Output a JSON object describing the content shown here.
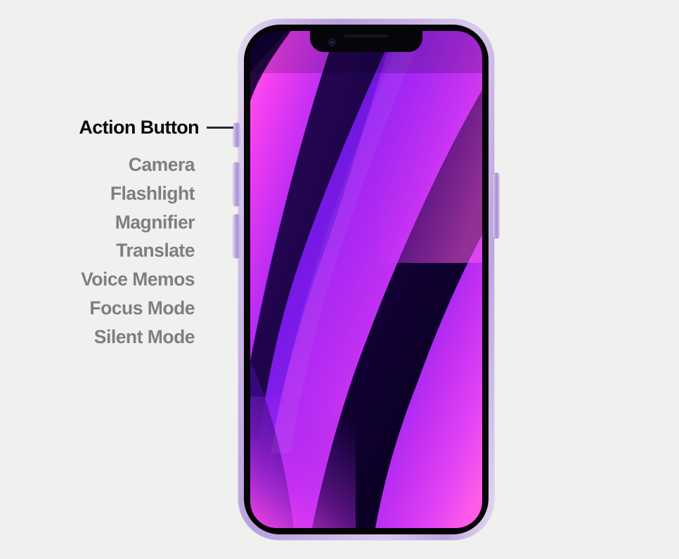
{
  "page": {
    "background_color": "#f0f0ef",
    "title": "iPhone Action Button callout diagram"
  },
  "callout": {
    "label": "Action Button",
    "label_color": "#0a0a0a",
    "leader_line_color": "#2a2a2a"
  },
  "options": {
    "text_color": "#807f7f",
    "items": [
      {
        "label": "Camera"
      },
      {
        "label": "Flashlight"
      },
      {
        "label": "Magnifier"
      },
      {
        "label": "Translate"
      },
      {
        "label": "Voice Memos"
      },
      {
        "label": "Focus Mode"
      },
      {
        "label": "Silent Mode"
      }
    ]
  },
  "phone": {
    "frame_color": "#c4ace0",
    "bezel_color": "#050406",
    "buttons": [
      {
        "name": "action-button",
        "side": "left"
      },
      {
        "name": "volume-up-button",
        "side": "left"
      },
      {
        "name": "volume-down-button",
        "side": "left"
      },
      {
        "name": "power-button",
        "side": "right"
      }
    ],
    "notch": {
      "camera": "front-camera",
      "speaker": "earpiece-speaker"
    },
    "wallpaper": {
      "style": "diagonal swoosh gradient",
      "colors": [
        "#0a0020",
        "#2a0a55",
        "#6a17d8",
        "#8b22f0",
        "#c32ff0",
        "#ee4df5",
        "#ff5ce8"
      ]
    }
  }
}
